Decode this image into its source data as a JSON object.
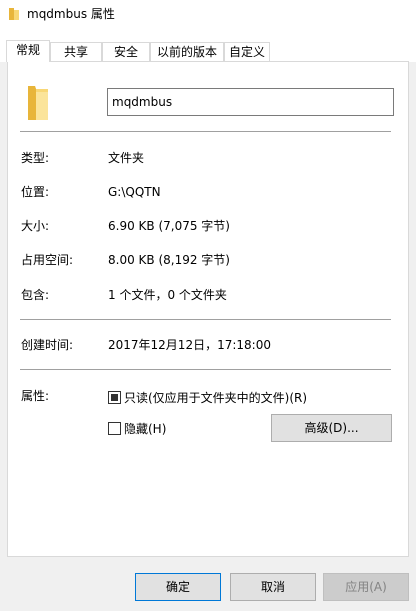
{
  "window": {
    "title": "mqdmbus 属性"
  },
  "tabs": [
    {
      "label": "常规",
      "active": true
    },
    {
      "label": "共享",
      "active": false
    },
    {
      "label": "安全",
      "active": false
    },
    {
      "label": "以前的版本",
      "active": false
    },
    {
      "label": "自定义",
      "active": false
    }
  ],
  "general": {
    "name_value": "mqdmbus",
    "fields": [
      {
        "label": "类型:",
        "value": "文件夹"
      },
      {
        "label": "位置:",
        "value": "G:\\QQTN"
      },
      {
        "label": "大小:",
        "value": "6.90 KB (7,075 字节)"
      },
      {
        "label": "占用空间:",
        "value": "8.00 KB (8,192 字节)"
      },
      {
        "label": "包含:",
        "value": "1 个文件，0 个文件夹"
      }
    ],
    "created": {
      "label": "创建时间:",
      "value": "2017年12月12日，17:18:00"
    },
    "attributes": {
      "label": "属性:",
      "readonly_label": "只读(仅应用于文件夹中的文件)(R)",
      "hidden_label": "隐藏(H)",
      "advanced_label": "高级(D)..."
    }
  },
  "footer": {
    "ok_label": "确定",
    "cancel_label": "取消",
    "apply_label": "应用(A)"
  },
  "colors": {
    "folder_yellow": "#f8d775",
    "folder_dark": "#e8b53a",
    "accent_border": "#0078d7"
  }
}
